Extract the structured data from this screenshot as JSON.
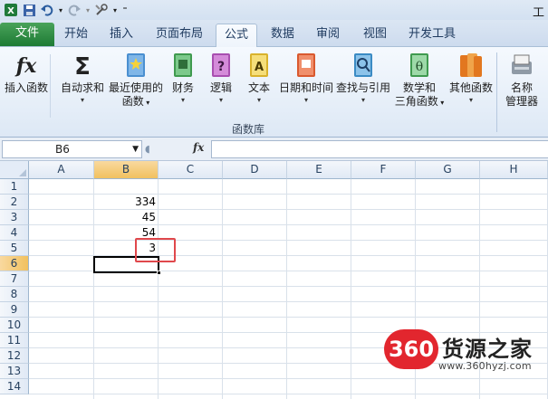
{
  "qat": {
    "title_fragment": "工"
  },
  "tabs": [
    {
      "label": "文件"
    },
    {
      "label": "开始"
    },
    {
      "label": "插入"
    },
    {
      "label": "页面布局"
    },
    {
      "label": "公式"
    },
    {
      "label": "数据"
    },
    {
      "label": "审阅"
    },
    {
      "label": "视图"
    },
    {
      "label": "开发工具"
    }
  ],
  "ribbon": {
    "group_label": "函数库",
    "buttons": [
      {
        "label": "插入函数",
        "icon": "fx-icon"
      },
      {
        "label": "自动求和",
        "icon": "sigma-icon"
      },
      {
        "label": "最近使用的",
        "label2": "函数",
        "icon": "recent-book-icon"
      },
      {
        "label": "财务",
        "icon": "financial-book-icon"
      },
      {
        "label": "逻辑",
        "icon": "logic-book-icon"
      },
      {
        "label": "文本",
        "icon": "text-book-icon"
      },
      {
        "label": "日期和时间",
        "icon": "datetime-book-icon"
      },
      {
        "label": "查找与引用",
        "icon": "lookup-book-icon"
      },
      {
        "label": "数学和",
        "label2": "三角函数",
        "icon": "math-book-icon"
      },
      {
        "label": "其他函数",
        "icon": "more-books-icon"
      },
      {
        "label": "名称",
        "label2": "管理器",
        "icon": "name-manager-icon"
      }
    ]
  },
  "formula_bar": {
    "name_box": "B6",
    "fx_label": "fx",
    "formula": ""
  },
  "sheet": {
    "columns": [
      "A",
      "B",
      "C",
      "D",
      "E",
      "F",
      "G",
      "H"
    ],
    "rows": [
      "1",
      "2",
      "3",
      "4",
      "5",
      "6",
      "7",
      "8",
      "9",
      "10",
      "11",
      "12",
      "13",
      "14"
    ],
    "selected_cell": "B6",
    "cells": [
      {
        "ref": "B2",
        "value": "334"
      },
      {
        "ref": "B3",
        "value": "45"
      },
      {
        "ref": "B4",
        "value": "54"
      },
      {
        "ref": "B5",
        "value": "3"
      }
    ]
  },
  "watermark": {
    "badge": "360",
    "name": "货源之家",
    "url": "www.360hyzj.com"
  },
  "colors": {
    "file_tab": "#1d7a34",
    "highlight": "#e0484c",
    "selected_header": "#f1c15f"
  }
}
